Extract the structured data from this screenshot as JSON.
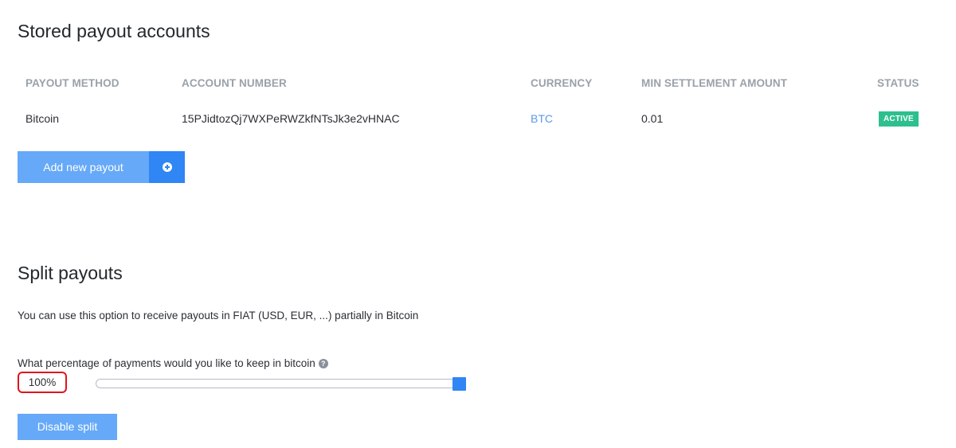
{
  "stored": {
    "title": "Stored payout accounts",
    "columns": {
      "method": "PAYOUT METHOD",
      "account": "ACCOUNT NUMBER",
      "currency": "CURRENCY",
      "min": "MIN SETTLEMENT AMOUNT",
      "status": "STATUS"
    },
    "rows": [
      {
        "method": "Bitcoin",
        "account": "15PJidtozQj7WXPeRWZkfNTsJk3e2vHNAC",
        "currency": "BTC",
        "min": "0.01",
        "status": "ACTIVE"
      }
    ],
    "add_button": {
      "label": "Add new payout",
      "icon": "plus-circle-icon"
    }
  },
  "split": {
    "title": "Split payouts",
    "description": "You can use this option to receive payouts in FIAT (USD, EUR, ...) partially in Bitcoin",
    "question": "What percentage of payments would you like to keep in bitcoin",
    "help_icon": "?",
    "percentage_display": "100%",
    "percentage_value": 100,
    "disable_button": "Disable split"
  },
  "colors": {
    "accent": "#2f86f4",
    "button_light": "#66a9f8",
    "active_badge": "#2ebf8f",
    "highlight_border": "#e0141e",
    "link": "#5a9be5"
  }
}
